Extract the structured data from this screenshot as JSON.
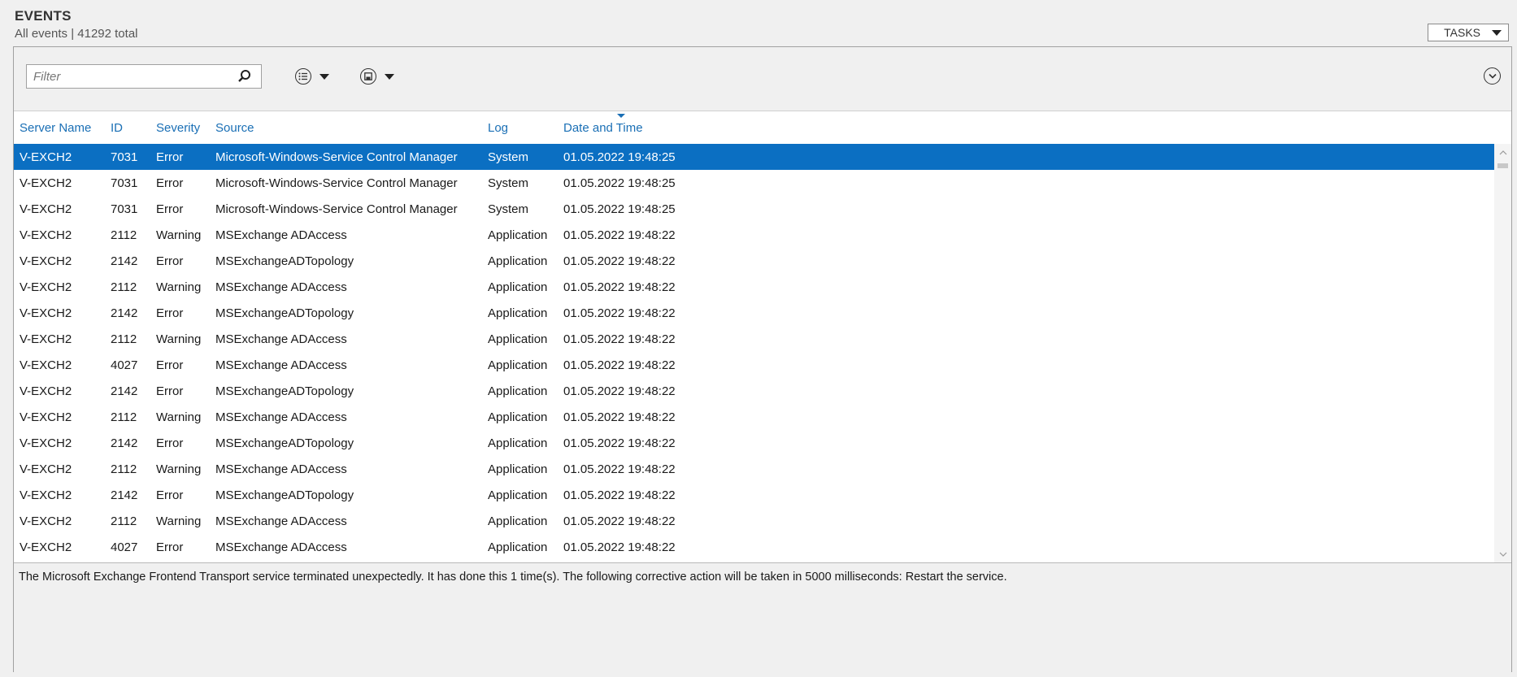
{
  "header": {
    "title": "EVENTS",
    "subtitle": "All events | 41292 total",
    "tasks_label": "TASKS"
  },
  "toolbar": {
    "filter_placeholder": "Filter"
  },
  "columns": [
    "Server Name",
    "ID",
    "Severity",
    "Source",
    "Log",
    "Date and Time"
  ],
  "rows": [
    {
      "server": "V-EXCH2",
      "id": "7031",
      "severity": "Error",
      "source": "Microsoft-Windows-Service Control Manager",
      "log": "System",
      "datetime": "01.05.2022 19:48:25"
    },
    {
      "server": "V-EXCH2",
      "id": "7031",
      "severity": "Error",
      "source": "Microsoft-Windows-Service Control Manager",
      "log": "System",
      "datetime": "01.05.2022 19:48:25"
    },
    {
      "server": "V-EXCH2",
      "id": "7031",
      "severity": "Error",
      "source": "Microsoft-Windows-Service Control Manager",
      "log": "System",
      "datetime": "01.05.2022 19:48:25"
    },
    {
      "server": "V-EXCH2",
      "id": "2112",
      "severity": "Warning",
      "source": "MSExchange ADAccess",
      "log": "Application",
      "datetime": "01.05.2022 19:48:22"
    },
    {
      "server": "V-EXCH2",
      "id": "2142",
      "severity": "Error",
      "source": "MSExchangeADTopology",
      "log": "Application",
      "datetime": "01.05.2022 19:48:22"
    },
    {
      "server": "V-EXCH2",
      "id": "2112",
      "severity": "Warning",
      "source": "MSExchange ADAccess",
      "log": "Application",
      "datetime": "01.05.2022 19:48:22"
    },
    {
      "server": "V-EXCH2",
      "id": "2142",
      "severity": "Error",
      "source": "MSExchangeADTopology",
      "log": "Application",
      "datetime": "01.05.2022 19:48:22"
    },
    {
      "server": "V-EXCH2",
      "id": "2112",
      "severity": "Warning",
      "source": "MSExchange ADAccess",
      "log": "Application",
      "datetime": "01.05.2022 19:48:22"
    },
    {
      "server": "V-EXCH2",
      "id": "4027",
      "severity": "Error",
      "source": "MSExchange ADAccess",
      "log": "Application",
      "datetime": "01.05.2022 19:48:22"
    },
    {
      "server": "V-EXCH2",
      "id": "2142",
      "severity": "Error",
      "source": "MSExchangeADTopology",
      "log": "Application",
      "datetime": "01.05.2022 19:48:22"
    },
    {
      "server": "V-EXCH2",
      "id": "2112",
      "severity": "Warning",
      "source": "MSExchange ADAccess",
      "log": "Application",
      "datetime": "01.05.2022 19:48:22"
    },
    {
      "server": "V-EXCH2",
      "id": "2142",
      "severity": "Error",
      "source": "MSExchangeADTopology",
      "log": "Application",
      "datetime": "01.05.2022 19:48:22"
    },
    {
      "server": "V-EXCH2",
      "id": "2112",
      "severity": "Warning",
      "source": "MSExchange ADAccess",
      "log": "Application",
      "datetime": "01.05.2022 19:48:22"
    },
    {
      "server": "V-EXCH2",
      "id": "2142",
      "severity": "Error",
      "source": "MSExchangeADTopology",
      "log": "Application",
      "datetime": "01.05.2022 19:48:22"
    },
    {
      "server": "V-EXCH2",
      "id": "2112",
      "severity": "Warning",
      "source": "MSExchange ADAccess",
      "log": "Application",
      "datetime": "01.05.2022 19:48:22"
    },
    {
      "server": "V-EXCH2",
      "id": "4027",
      "severity": "Error",
      "source": "MSExchange ADAccess",
      "log": "Application",
      "datetime": "01.05.2022 19:48:22"
    }
  ],
  "selected_row": 0,
  "detail_text": "The Microsoft Exchange Frontend Transport service terminated unexpectedly.  It has done this 1 time(s).  The following corrective action will be taken in 5000 milliseconds: Restart the service.",
  "colors": {
    "accent": "#0b6fc2",
    "header_link": "#1a6fb5"
  },
  "icons": {
    "filter": "search-icon",
    "view_options": "list-view-icon",
    "save_options": "save-icon",
    "expand": "chevron-down-icon"
  }
}
